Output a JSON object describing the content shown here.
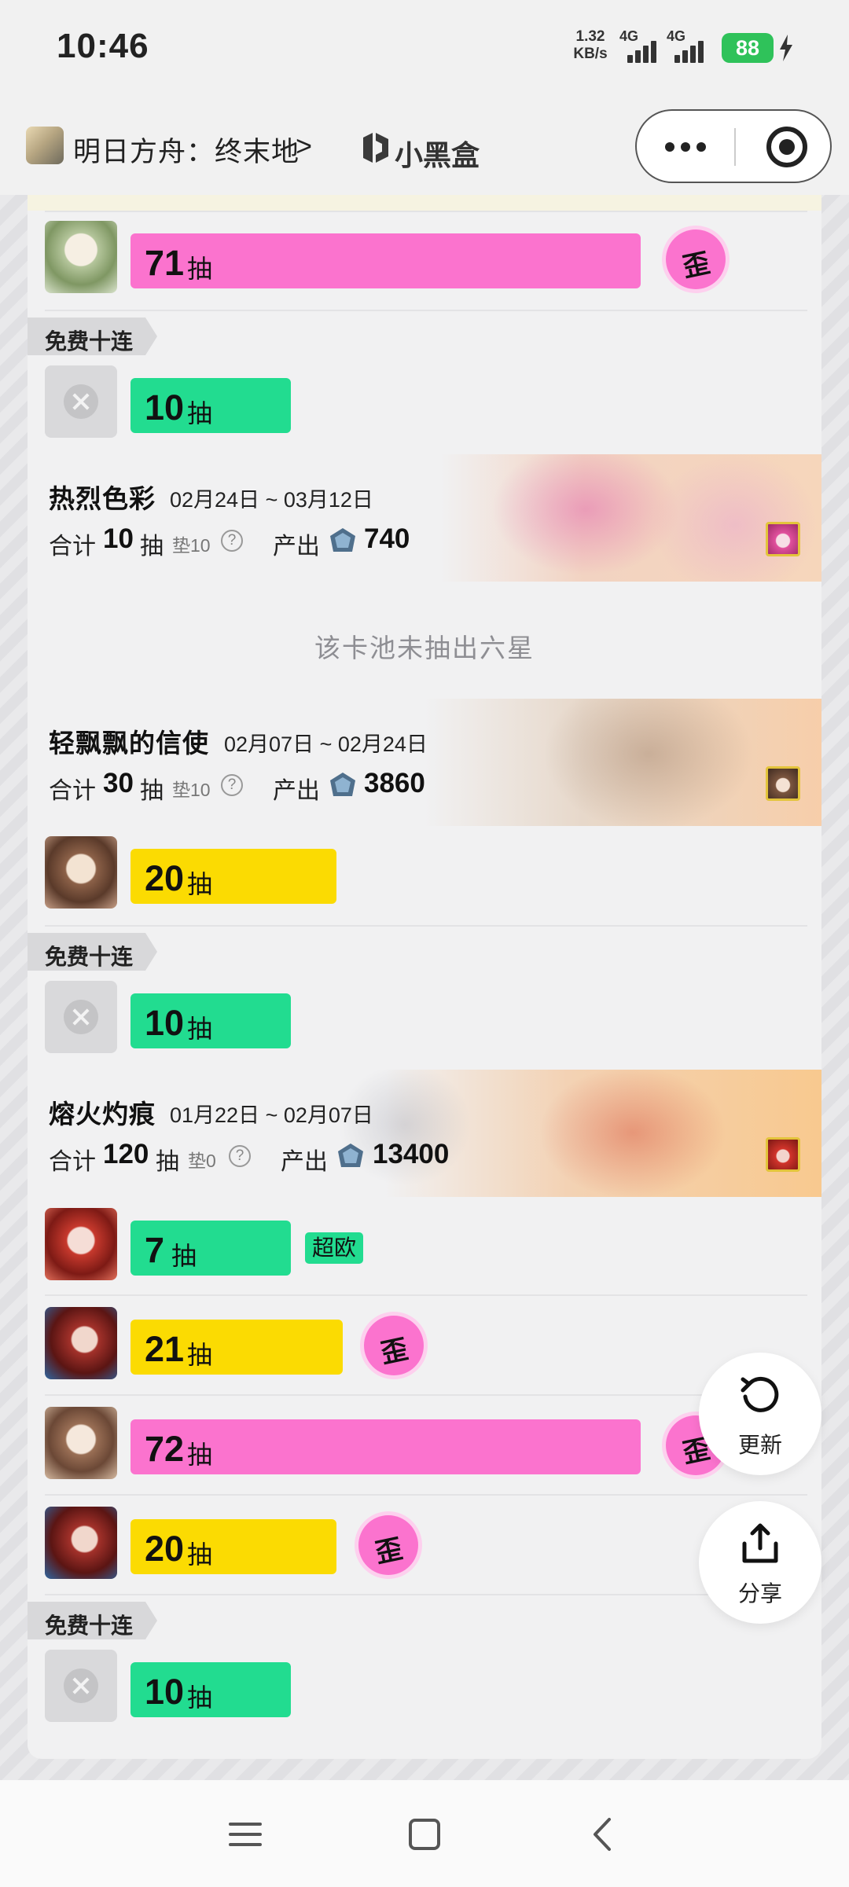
{
  "status_bar": {
    "time": "10:46",
    "net_speed_value": "1.32",
    "net_speed_unit": "KB/s",
    "signal1_label": "4G",
    "signal2_label": "4G",
    "battery": "88"
  },
  "header": {
    "app_title": "明日方舟：终末地",
    "chevron": ">",
    "brand_name": "小黑盒"
  },
  "card": {
    "rows": [
      {
        "count": "71",
        "unit": "抽",
        "color": "#fb73ce",
        "tag": "歪"
      },
      {
        "count": "10",
        "unit": "抽",
        "color": "#22dc90"
      }
    ],
    "free_tag": "免费十连",
    "pools": [
      {
        "name": "热烈色彩",
        "date": "02月24日 ~ 03月12日",
        "total_label": "合计",
        "total": "10",
        "total_unit": "抽",
        "pity": "垫10",
        "help": "?",
        "output_label": "产出",
        "output": "740"
      },
      {
        "name": "轻飘飘的信使",
        "date": "02月07日 ~ 02月24日",
        "total_label": "合计",
        "total": "30",
        "total_unit": "抽",
        "pity": "垫10",
        "help": "?",
        "output_label": "产出",
        "output": "3860"
      },
      {
        "name": "熔火灼痕",
        "date": "01月22日 ~ 02月07日",
        "total_label": "合计",
        "total": "120",
        "total_unit": "抽",
        "pity": "垫0",
        "help": "?",
        "output_label": "产出",
        "output": "13400"
      }
    ],
    "no_six_star_note": "该卡池未抽出六星",
    "pool2_rows": [
      {
        "count": "20",
        "unit": "抽",
        "color": "#fbdb02"
      },
      {
        "count": "10",
        "unit": "抽",
        "color": "#22dc90"
      }
    ],
    "pool3_rows": [
      {
        "count": "7",
        "unit": "抽",
        "color": "#22dc90",
        "badge": "超欧"
      },
      {
        "count": "21",
        "unit": "抽",
        "color": "#fbdb02",
        "tag": "歪"
      },
      {
        "count": "72",
        "unit": "抽",
        "color": "#fb73ce",
        "tag": "歪"
      },
      {
        "count": "20",
        "unit": "抽",
        "color": "#fbdb02",
        "tag": "歪"
      },
      {
        "count": "10",
        "unit": "抽",
        "color": "#22dc90"
      }
    ]
  },
  "fab": {
    "refresh": "更新",
    "share": "分享"
  },
  "colors": {
    "green": "#22dc90",
    "yellow": "#fbdb02",
    "pink": "#fb73ce",
    "battery": "#2fc25a"
  }
}
